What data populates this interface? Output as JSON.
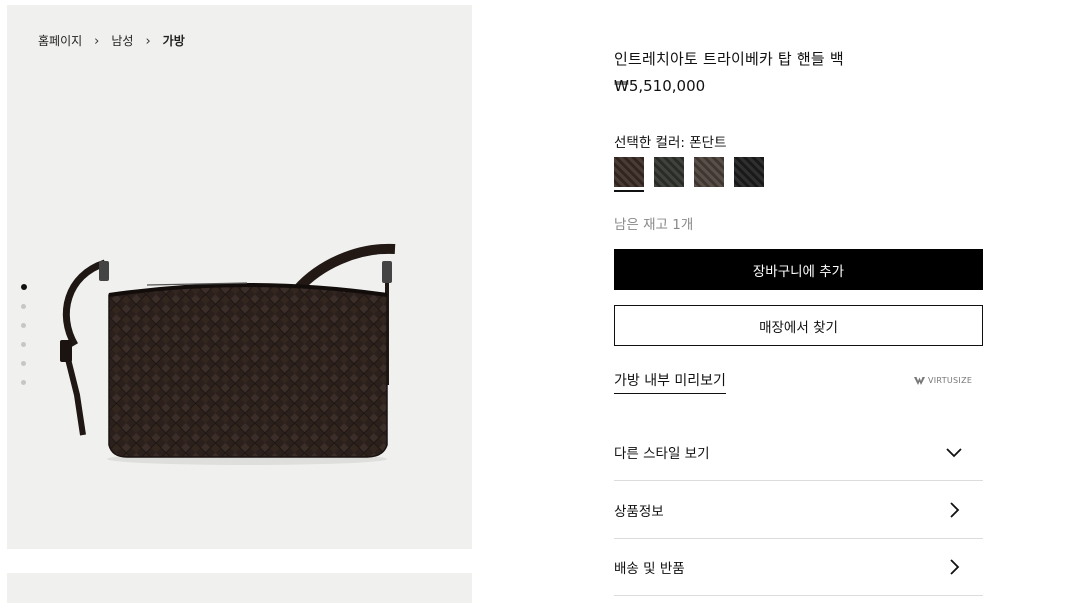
{
  "breadcrumb": {
    "home": "홈페이지",
    "level1": "남성",
    "current": "가방"
  },
  "gallery": {
    "slides": 6,
    "active_index": 0
  },
  "product": {
    "title": "인트레치아토 트라이베카 탑 핸들 백",
    "price": "₩5,510,000",
    "color_label": "선택한 컬러: 폰단트",
    "swatches": [
      {
        "name": "폰단트",
        "color": "#3a2a24",
        "selected": true
      },
      {
        "name": "dark-green",
        "color": "#2f322d",
        "selected": false
      },
      {
        "name": "brown-grey",
        "color": "#4a4039",
        "selected": false
      },
      {
        "name": "black",
        "color": "#1d1d1d",
        "selected": false
      }
    ],
    "stock": "남은 재고 1개"
  },
  "actions": {
    "add_to_cart": "장바구니에 추가",
    "find_in_store": "매장에서 찾기"
  },
  "preview": {
    "label": "가방 내부 미리보기",
    "brand": "VIRTUSIZE"
  },
  "accordion": [
    {
      "label": "다른 스타일 보기",
      "icon": "chevron-down-icon"
    },
    {
      "label": "상품정보",
      "icon": "chevron-right-icon"
    },
    {
      "label": "배송 및 반품",
      "icon": "chevron-right-icon"
    }
  ]
}
